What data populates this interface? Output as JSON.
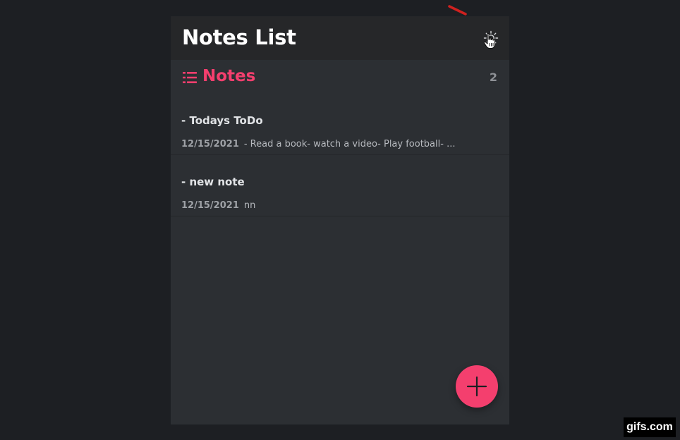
{
  "header": {
    "title": "Notes List",
    "theme_toggle_icon": "sun-icon"
  },
  "section": {
    "icon": "menu-lines-icon",
    "title": "Notes",
    "count": "2"
  },
  "notes": [
    {
      "title": "- Todays ToDo",
      "date": "12/15/2021",
      "preview": "- Read a book- watch a video- Play football- ..."
    },
    {
      "title": "- new note",
      "date": "12/15/2021",
      "preview": "nn"
    }
  ],
  "fab": {
    "icon": "plus-icon"
  },
  "watermark": {
    "text": "gifs.com"
  },
  "colors": {
    "accent": "#f43f6e",
    "background": "#1d1f23",
    "panel": "#2c2f33",
    "header": "#262729"
  }
}
